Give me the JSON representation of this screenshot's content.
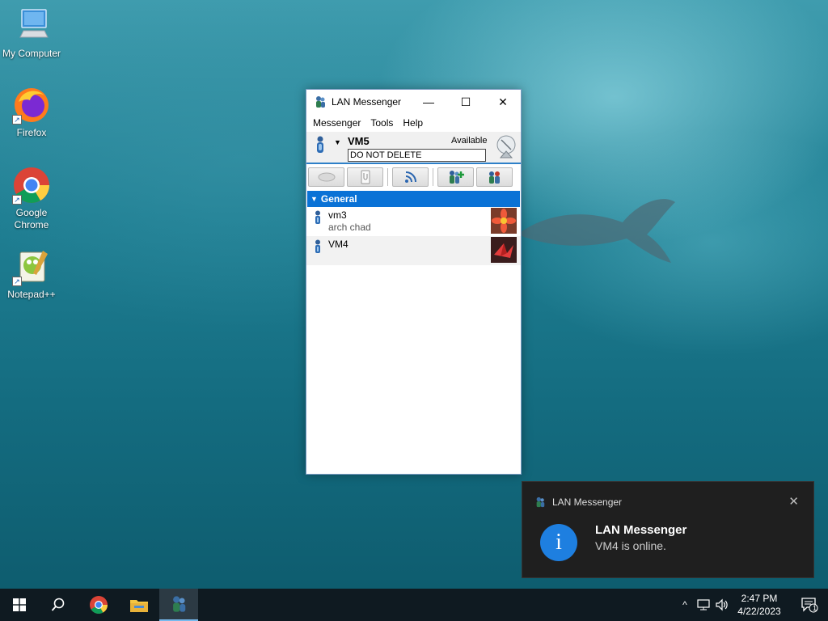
{
  "desktop": {
    "icons": [
      {
        "label": "My Computer"
      },
      {
        "label": "Firefox"
      },
      {
        "label": "Google Chrome"
      },
      {
        "label": "Notepad++"
      }
    ]
  },
  "window": {
    "title": "LAN Messenger",
    "controls": {
      "minimize": "—",
      "maximize": "☐",
      "close": "✕"
    },
    "menu": [
      "Messenger",
      "Tools",
      "Help"
    ],
    "profile": {
      "name": "VM5",
      "status": "Available",
      "note_value": "DO NOT DELETE"
    },
    "groups": [
      {
        "name": "General",
        "contacts": [
          {
            "name": "vm3",
            "note": "arch chad"
          },
          {
            "name": "VM4",
            "note": ""
          }
        ]
      }
    ]
  },
  "notification": {
    "app_name": "LAN Messenger",
    "title": "LAN Messenger",
    "message": "VM4 is online.",
    "close": "✕",
    "info_glyph": "i"
  },
  "taskbar": {
    "items": [
      "start-icon",
      "search-icon",
      "chrome-icon",
      "file-explorer-icon",
      "lan-messenger-icon"
    ],
    "active_item": "lan-messenger-icon",
    "tray_chevron": "^",
    "time": "2:47 PM",
    "date": "4/22/2023",
    "notification_count": "1"
  },
  "colors": {
    "accent": "#0a72d6",
    "profile_divider": "#2e80c8",
    "toast_bg": "#1f1f1f",
    "taskbar_bg": "#0f1a21",
    "info_blue": "#1e7fe0"
  }
}
